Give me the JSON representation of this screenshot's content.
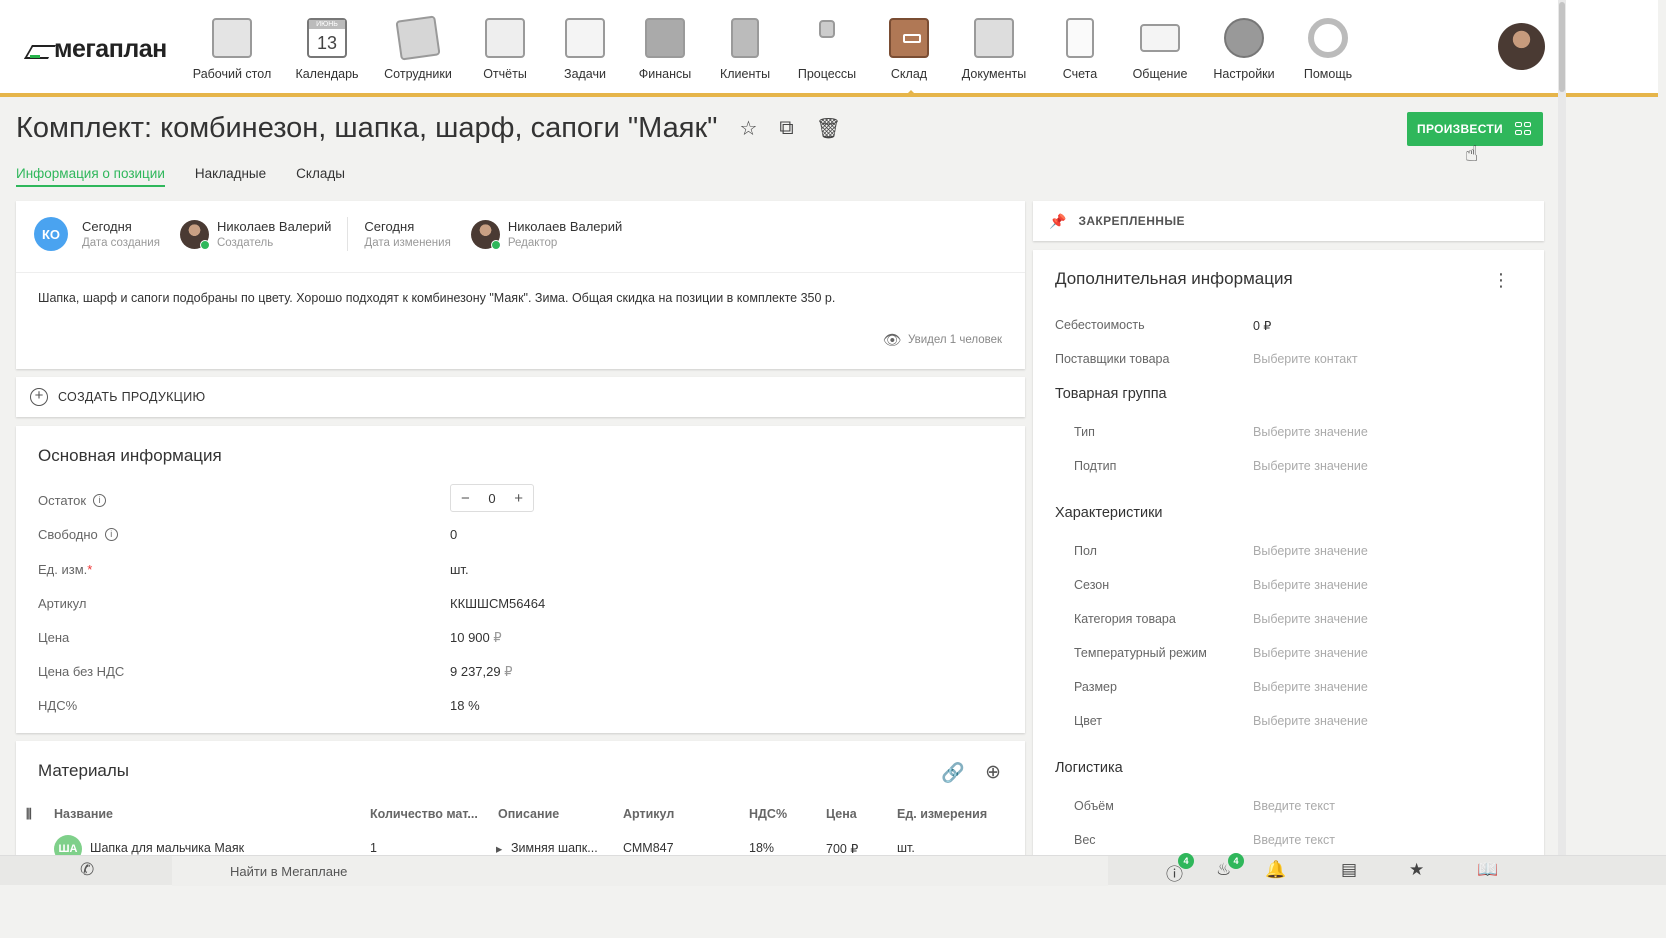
{
  "logo": "мегаплан",
  "nav": [
    {
      "label": "Рабочий стол",
      "icon": "desktop-icon"
    },
    {
      "label": "Календарь",
      "icon": "calendar-icon",
      "month": "ИЮНЬ",
      "day": "13"
    },
    {
      "label": "Сотрудники",
      "icon": "employees-icon"
    },
    {
      "label": "Отчёты",
      "icon": "reports-icon"
    },
    {
      "label": "Задачи",
      "icon": "tasks-icon"
    },
    {
      "label": "Финансы",
      "icon": "finance-icon"
    },
    {
      "label": "Клиенты",
      "icon": "clients-icon"
    },
    {
      "label": "Процессы",
      "icon": "processes-icon"
    },
    {
      "label": "Склад",
      "icon": "warehouse-icon",
      "active": true
    },
    {
      "label": "Документы",
      "icon": "documents-icon"
    },
    {
      "label": "Счета",
      "icon": "invoices-icon"
    },
    {
      "label": "Общение",
      "icon": "chat-icon"
    },
    {
      "label": "Настройки",
      "icon": "settings-icon"
    },
    {
      "label": "Помощь",
      "icon": "help-icon"
    }
  ],
  "header": {
    "title": "Комплект: комбинезон, шапка, шарф, сапоги \"Маяк\"",
    "produce_button": "ПРОИЗВЕСТИ"
  },
  "tabs": [
    "Информация о позиции",
    "Накладные",
    "Склады"
  ],
  "meta": {
    "initials": "КО",
    "created_value": "Сегодня",
    "created_label": "Дата создания",
    "creator_name": "Николаев Валерий",
    "creator_label": "Создатель",
    "modified_value": "Сегодня",
    "modified_label": "Дата изменения",
    "editor_name": "Николаев Валерий",
    "editor_label": "Редактор",
    "description": "Шапка, шарф и сапоги подобраны по цвету. Хорошо подходят к комбинезону \"Маяк\". Зима. Общая скидка на позиции в комплекте 350 р.",
    "seen": "Увидел 1 человек"
  },
  "create_production": "СОЗДАТЬ ПРОДУКЦИЮ",
  "main_info": {
    "title": "Основная информация",
    "stock_label": "Остаток",
    "stock_value": "0",
    "free_label": "Свободно",
    "free_value": "0",
    "unit_label": "Ед. изм.",
    "unit_required": "*",
    "unit_value": "шт.",
    "sku_label": "Артикул",
    "sku_value": "ККШШСМ56464",
    "price_label": "Цена",
    "price_value": "10 900",
    "price_net_label": "Цена без НДС",
    "price_net_value": "9 237,29",
    "currency": "₽",
    "vat_label": "НДС%",
    "vat_value": "18 %"
  },
  "materials": {
    "title": "Материалы",
    "columns": [
      "Название",
      "Количество мат...",
      "Описание",
      "Артикул",
      "НДС%",
      "Цена",
      "Ед. измерения"
    ],
    "rows": [
      {
        "avatar": "ША",
        "name": "Шапка для мальчика Маяк",
        "qty": "1",
        "desc": "Зимняя шапк...",
        "sku": "СММ847",
        "vat": "18%",
        "price": "700 ₽",
        "unit": "шт."
      }
    ]
  },
  "pinned": "ЗАКРЕПЛЕННЫЕ",
  "extra": {
    "title": "Дополнительная информация",
    "cost_label": "Себестоимость",
    "cost_value": "0 ₽",
    "suppliers_label": "Поставщики товара",
    "suppliers_value": "Выберите контакт",
    "group_title": "Товарная группа",
    "type_label": "Тип",
    "subtype_label": "Подтип",
    "chars_title": "Характеристики",
    "gender_label": "Пол",
    "season_label": "Сезон",
    "category_label": "Категория товара",
    "temp_label": "Температурный режим",
    "size_label": "Размер",
    "color_label": "Цвет",
    "choose_value": "Выберите значение",
    "logistics_title": "Логистика",
    "volume_label": "Объём",
    "weight_label": "Вес",
    "enter_text": "Введите текст"
  },
  "bottom": {
    "search": "Найти в Мегаплане",
    "alerts_badge": "4",
    "fire_badge": "4"
  }
}
